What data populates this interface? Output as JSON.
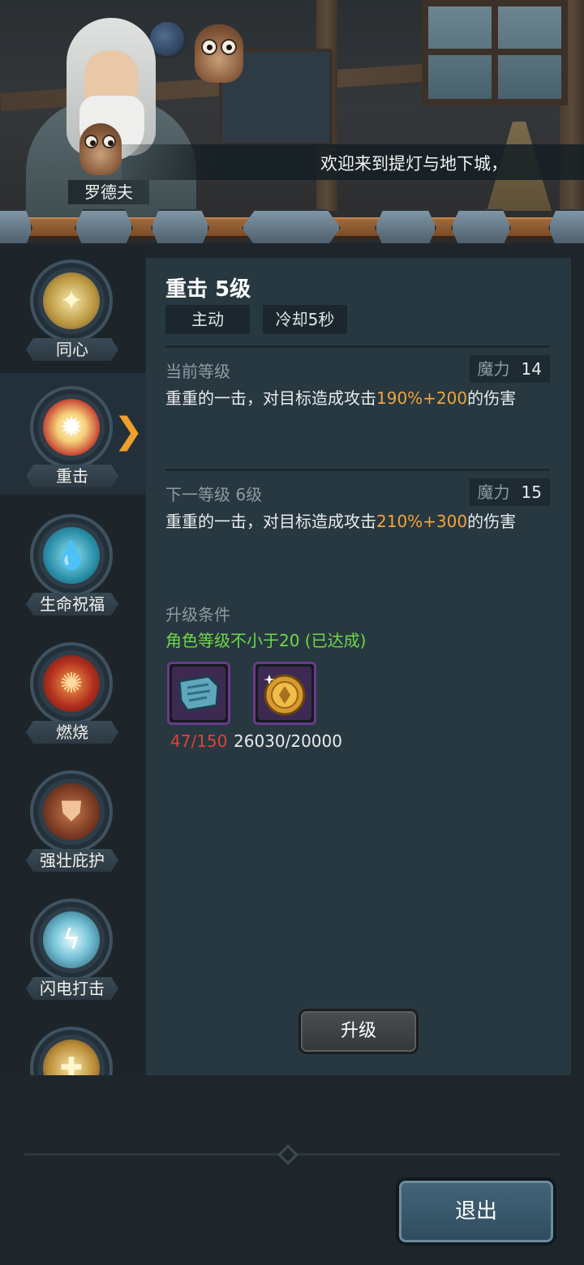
{
  "dialog": {
    "speaker": "罗德夫",
    "text": "欢迎来到提灯与地下城，"
  },
  "skills": [
    {
      "label": "同心",
      "icon": "sun-star-icon",
      "selected": false
    },
    {
      "label": "重击",
      "icon": "burst-icon",
      "selected": true
    },
    {
      "label": "生命祝福",
      "icon": "water-drop-icon",
      "selected": false
    },
    {
      "label": "燃烧",
      "icon": "fire-swirl-icon",
      "selected": false
    },
    {
      "label": "强壮庇护",
      "icon": "shield-rock-icon",
      "selected": false
    },
    {
      "label": "闪电打击",
      "icon": "lightning-orb-icon",
      "selected": false
    },
    {
      "label": "",
      "icon": "golden-cross-icon",
      "selected": false
    }
  ],
  "detail": {
    "title": "重击 5级",
    "tag_type": "主动",
    "tag_cooldown": "冷却5秒",
    "current": {
      "label": "当前等级",
      "mana_label": "魔力",
      "mana_value": "14",
      "desc_pre": "重重的一击，对目标造成攻击",
      "desc_hl": "190%+200",
      "desc_post": "的伤害"
    },
    "next": {
      "label": "下一等级 6级",
      "mana_label": "魔力",
      "mana_value": "15",
      "desc_pre": "重重的一击，对目标造成攻击",
      "desc_hl": "210%+300",
      "desc_post": "的伤害"
    },
    "requirements": {
      "label": "升级条件",
      "condition": "角色等级不小于20 (已达成)",
      "items": [
        {
          "icon": "scroll-map-icon",
          "count": "47/150",
          "count_color": "#e0413a"
        },
        {
          "icon": "gold-coin-icon",
          "count": "26030/20000",
          "count_color": "#e8eced"
        }
      ]
    },
    "upgrade_label": "升级"
  },
  "exit_label": "退出"
}
